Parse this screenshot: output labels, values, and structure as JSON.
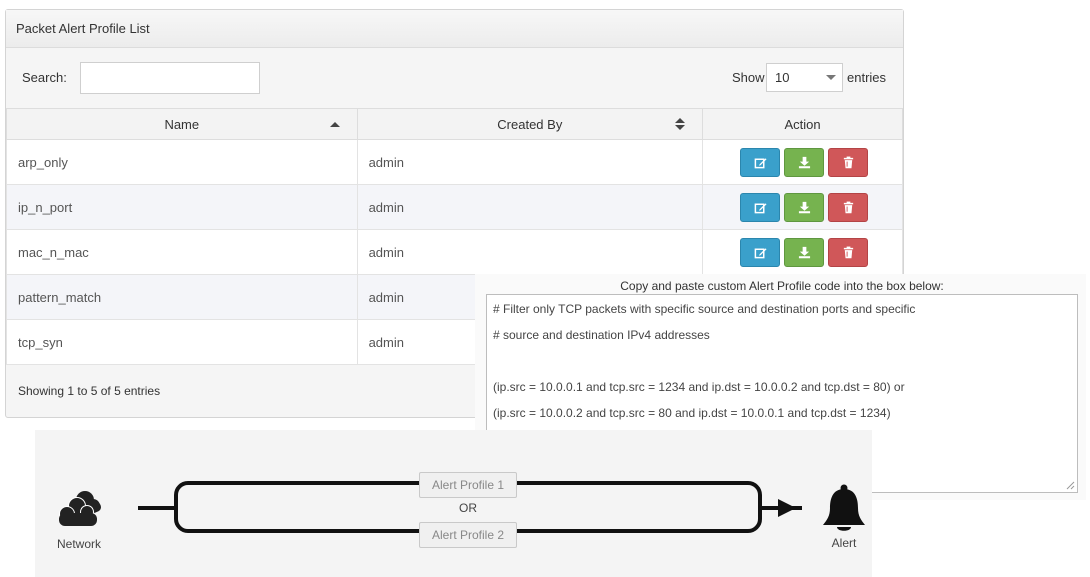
{
  "panel": {
    "title": "Packet Alert Profile List",
    "search_label": "Search:",
    "search_value": "",
    "show_label": "Show",
    "page_size": "10",
    "entries_label": "entries",
    "footer_info": "Showing 1 to 5 of 5 entries"
  },
  "table": {
    "columns": [
      "Name",
      "Created By",
      "Action"
    ],
    "rows": [
      {
        "name": "arp_only",
        "created_by": "admin"
      },
      {
        "name": "ip_n_port",
        "created_by": "admin"
      },
      {
        "name": "mac_n_mac",
        "created_by": "admin"
      },
      {
        "name": "pattern_match",
        "created_by": "admin"
      },
      {
        "name": "tcp_syn",
        "created_by": "admin"
      }
    ],
    "action_icons": [
      "edit-icon",
      "download-icon",
      "trash-icon"
    ]
  },
  "custom_code": {
    "label": "Copy and paste custom Alert Profile code into the box below:",
    "lines": [
      "# Filter only TCP packets with specific source and destination ports and specific",
      "# source and destination IPv4 addresses",
      "",
      "(ip.src = 10.0.0.1 and tcp.src = 1234 and ip.dst = 10.0.0.2 and tcp.dst = 80) or",
      "(ip.src = 10.0.0.2 and tcp.src = 80 and ip.dst = 10.0.0.1 and tcp.dst = 1234)"
    ]
  },
  "diagram": {
    "network_label": "Network",
    "profile_1": "Alert Profile 1",
    "or_label": "OR",
    "profile_2": "Alert Profile 2",
    "alert_label": "Alert"
  },
  "colors": {
    "edit": "#3aa0cb",
    "download": "#76b34f",
    "delete": "#d05759"
  }
}
